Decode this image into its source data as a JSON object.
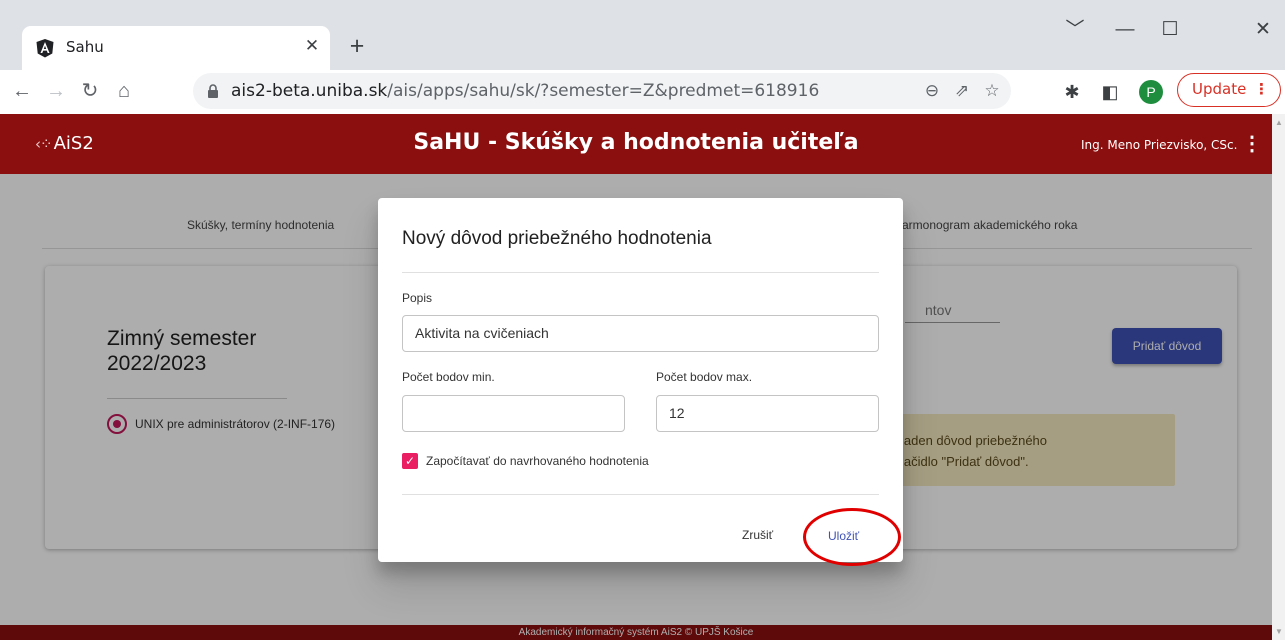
{
  "browser": {
    "tab_title": "Sahu",
    "url_domain": "ais2-beta.uniba.sk",
    "url_path": "/ais/apps/sahu/sk/?semester=Z&predmet=618916",
    "profile_initial": "P",
    "update_label": "Update"
  },
  "app": {
    "logo": "AiS2",
    "title": "SaHU - Skúšky a hodnotenia učiteľa",
    "user_name": "Ing. Meno Priezvisko, CSc."
  },
  "nav": {
    "tab_exams": "Skúšky, termíny hodnotenia",
    "tab_schedule": "armonogram akademického roka"
  },
  "card": {
    "semester_line1": "Zimný semester",
    "semester_line2": "2022/2023",
    "course": "UNIX pre administrátorov (2-INF-176)",
    "right_input_label": "ntov",
    "add_reason_button": "Pridať dôvod",
    "info_line1": "iaden dôvod priebežného",
    "info_line2": "lačidlo \"Pridať dôvod\"."
  },
  "footer": "Akademický informačný systém AiS2 © UPJŠ Košice",
  "dialog": {
    "title": "Nový dôvod priebežného hodnotenia",
    "description_label": "Popis",
    "description_value": "Aktivita na cvičeniach",
    "min_label": "Počet bodov min.",
    "min_value": "",
    "max_label": "Počet bodov max.",
    "max_value": "12",
    "checkbox_label": "Započítavať do navrhovaného hodnotenia",
    "checkbox_checked": true,
    "cancel": "Zrušiť",
    "save": "Uložiť"
  },
  "colors": {
    "header": "#8b0f0f",
    "primary": "#3f51b5",
    "accent": "#e91e63",
    "annotation": "#e00000"
  }
}
